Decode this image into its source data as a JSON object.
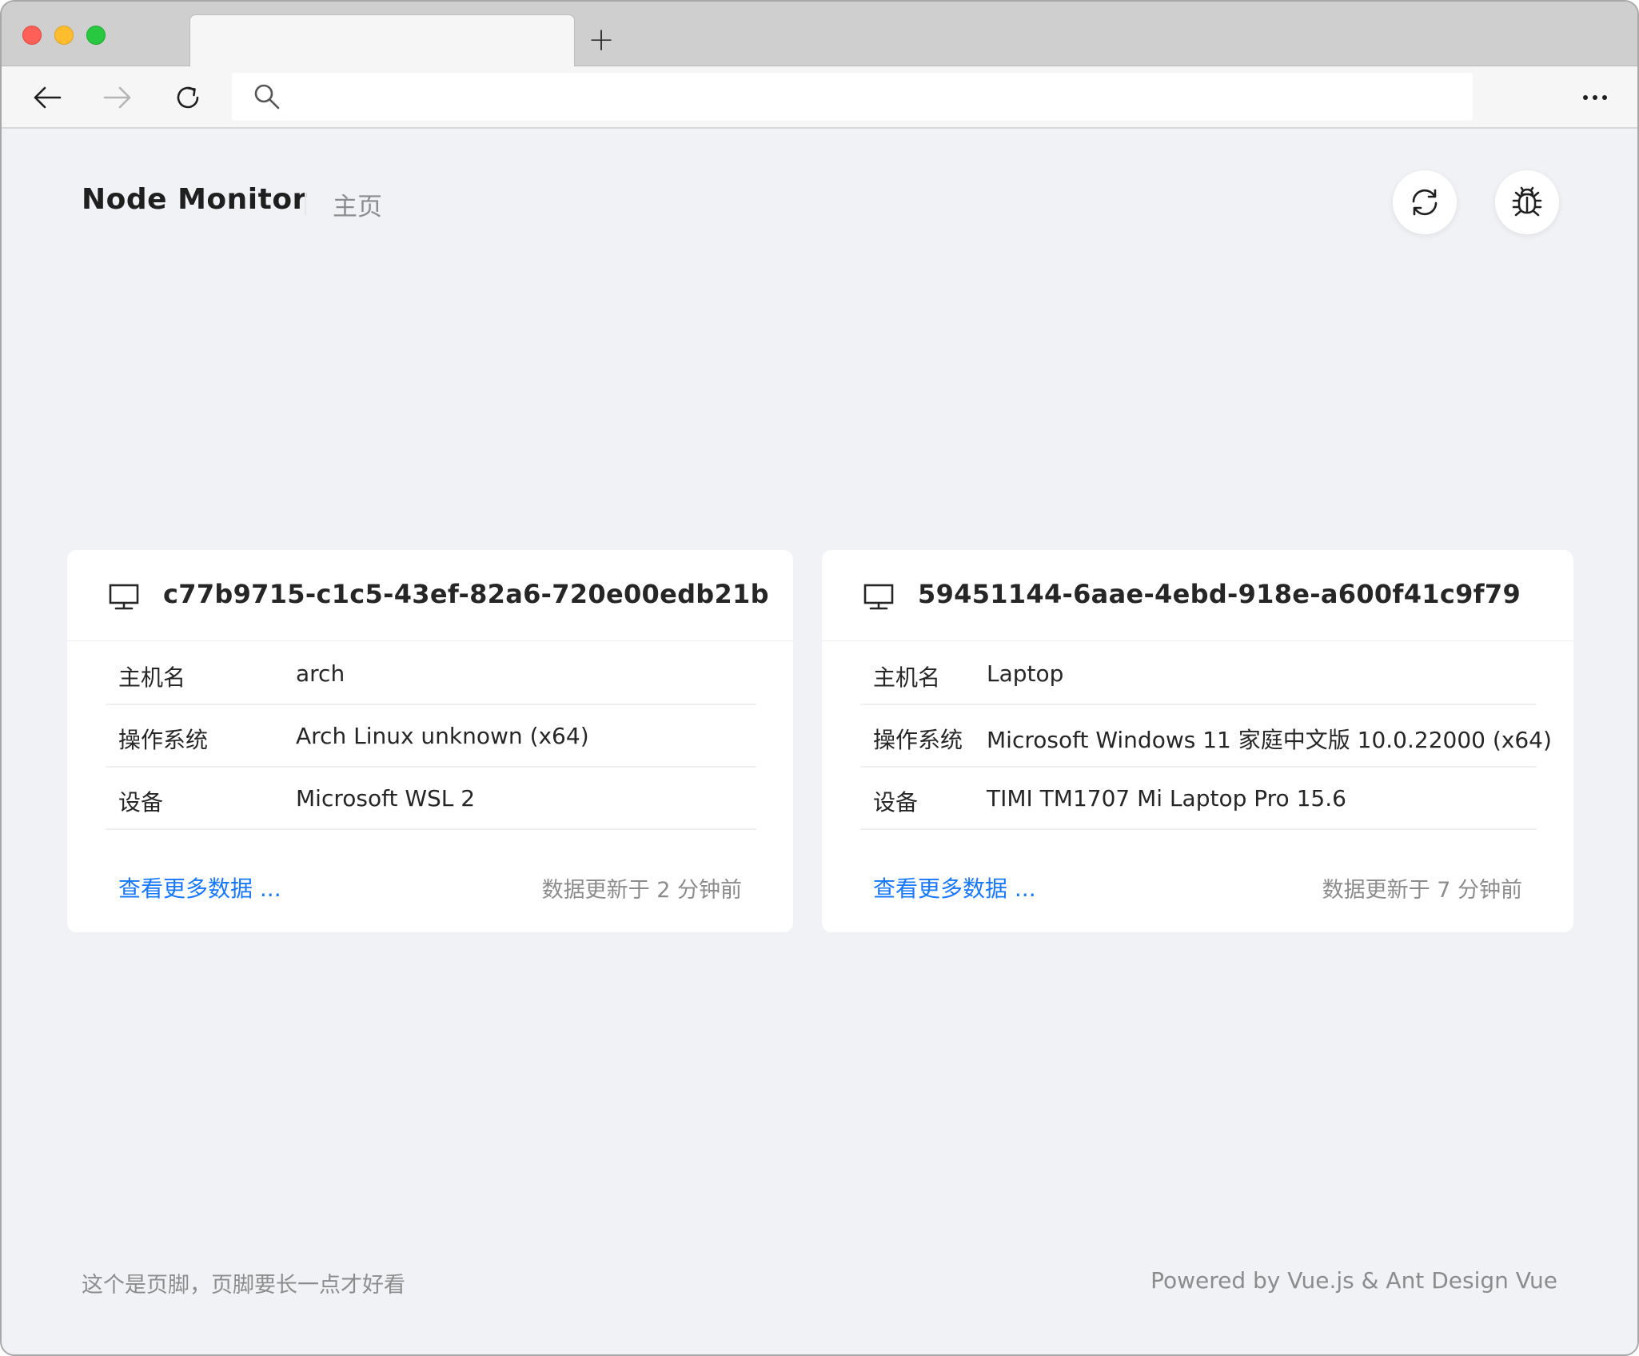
{
  "browser": {
    "window_controls": [
      "close",
      "minimize",
      "maximize"
    ],
    "new_tab_label": "+",
    "nav_icons": [
      "back-arrow-icon",
      "forward-arrow-icon",
      "reload-icon",
      "search-icon",
      "more-icon"
    ],
    "address_value": ""
  },
  "header": {
    "title": "Node Monitor",
    "breadcrumb": "主页",
    "actions": [
      "refresh-icon",
      "bug-icon"
    ]
  },
  "nodes": [
    {
      "id": "c77b9715-c1c5-43ef-82a6-720e00edb21b",
      "rows": [
        {
          "key": "主机名",
          "value": "arch"
        },
        {
          "key": "操作系统",
          "value": "Arch Linux unknown (x64)"
        },
        {
          "key": "设备",
          "value": "Microsoft WSL 2"
        }
      ],
      "more_link": "查看更多数据 ...",
      "updated": "数据更新于 2 分钟前"
    },
    {
      "id": "59451144-6aae-4ebd-918e-a600f41c9f79",
      "rows": [
        {
          "key": "主机名",
          "value": "Laptop"
        },
        {
          "key": "操作系统",
          "value": "Microsoft Windows 11 家庭中文版 10.0.22000 (x64)"
        },
        {
          "key": "设备",
          "value": "TIMI TM1707 Mi Laptop Pro 15.6"
        }
      ],
      "more_link": "查看更多数据 ...",
      "updated": "数据更新于 7 分钟前"
    }
  ],
  "footer": {
    "left": "这个是页脚，页脚要长一点才好看",
    "right": "Powered by Vue.js & Ant Design Vue"
  },
  "colors": {
    "link": "#1677ff",
    "page_bg": "#f0f2f5",
    "muted_text": "#8c8c8c"
  }
}
